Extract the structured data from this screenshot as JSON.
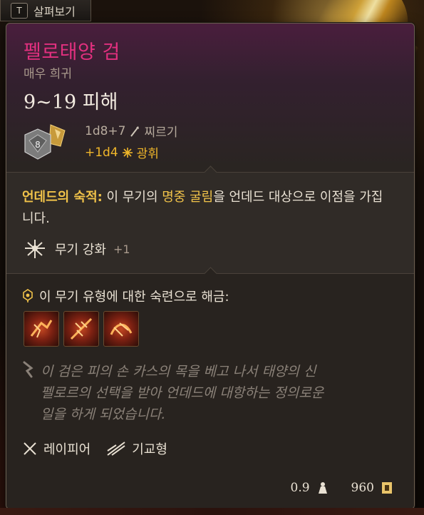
{
  "inspect": {
    "key": "T",
    "label": "살펴보기"
  },
  "item": {
    "name": "펠로태양 검",
    "rarity": "매우 희귀",
    "damage": "9~19 피해",
    "die": "8",
    "base_roll": "1d8+7",
    "base_type": "찌르기",
    "bonus_roll": "+1d4",
    "bonus_type": "광휘"
  },
  "passive": {
    "name": "언데드의 숙적:",
    "text_a": " 이 무기의 ",
    "highlight": "명중 굴림",
    "text_b": "을 언데드 대상으로 이점을 가집니다."
  },
  "weapon_boost": {
    "label": "무기 강화",
    "value": "+1"
  },
  "proficiency": {
    "label": "이 무기 유형에 대한 숙련으로 해금:"
  },
  "actions": [
    {
      "name": "action-1"
    },
    {
      "name": "action-2"
    },
    {
      "name": "action-3"
    }
  ],
  "lore": "이 검은 피의 손 카스의 목을 베고 나서 태양의 신\n펠로르의 선택을 받아 언데드에 대항하는 정의로운\n일을 하게 되었습니다.",
  "tags": {
    "weapon_type": "레이피어",
    "property": "기교형"
  },
  "footer": {
    "weight": "0.9",
    "price": "960"
  },
  "colors": {
    "name": "#e2307f",
    "gold": "#f1c34a",
    "radiant": "#f0b62a"
  }
}
